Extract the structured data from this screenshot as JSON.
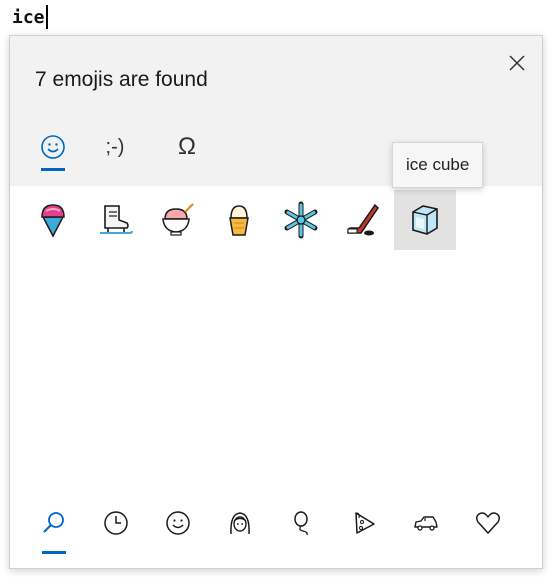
{
  "editor": {
    "typed_text": "ice"
  },
  "picker": {
    "title": "7 emojis are found",
    "close_icon": "close-icon",
    "tabs": [
      {
        "name": "emoji",
        "icon": "smiley-icon",
        "active": true
      },
      {
        "name": "kaomoji",
        "label": ";-)",
        "active": false
      },
      {
        "name": "symbols",
        "label": "Ω",
        "active": false
      }
    ],
    "tooltip": "ice cube",
    "results": [
      {
        "name": "shaved ice",
        "icon": "shaved-ice-icon"
      },
      {
        "name": "ice skate",
        "icon": "ice-skate-icon"
      },
      {
        "name": "shaved ice bowl",
        "icon": "shaved-ice-bowl-icon"
      },
      {
        "name": "ice cream",
        "icon": "ice-cream-icon"
      },
      {
        "name": "snowflake",
        "icon": "snowflake-icon"
      },
      {
        "name": "ice hockey",
        "icon": "ice-hockey-icon"
      },
      {
        "name": "ice cube",
        "icon": "ice-cube-icon",
        "selected": true
      }
    ],
    "categories": [
      {
        "icon": "search-icon",
        "active": true
      },
      {
        "icon": "clock-icon"
      },
      {
        "icon": "smiley-face-icon"
      },
      {
        "icon": "person-icon"
      },
      {
        "icon": "balloon-icon"
      },
      {
        "icon": "pizza-icon"
      },
      {
        "icon": "car-icon"
      },
      {
        "icon": "heart-icon"
      }
    ],
    "accent_color": "#0067c0",
    "selected_bg": "#e2e2e2"
  }
}
